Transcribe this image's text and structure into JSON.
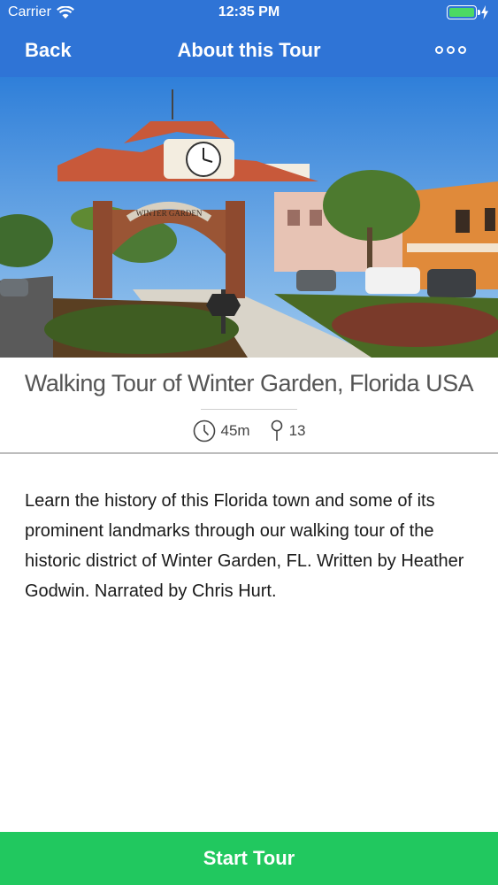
{
  "status_bar": {
    "carrier": "Carrier",
    "time": "12:35 PM",
    "battery_color": "#4cd964"
  },
  "nav": {
    "back_label": "Back",
    "title": "About this Tour",
    "more_icon": "more-icon",
    "background": "#2f74d6"
  },
  "hero_image": {
    "description_icon": "photo",
    "sign_text": "WINTER GARDEN"
  },
  "tour": {
    "title": "Walking Tour of Winter Garden, Florida USA",
    "duration": "45m",
    "stops": "13",
    "description": "Learn the history of this Florida town and some of its prominent landmarks through our walking tour of the historic district of Winter Garden, FL. Written by Heather Godwin. Narrated by Chris Hurt."
  },
  "footer": {
    "start_label": "Start Tour",
    "background": "#21c85f"
  }
}
